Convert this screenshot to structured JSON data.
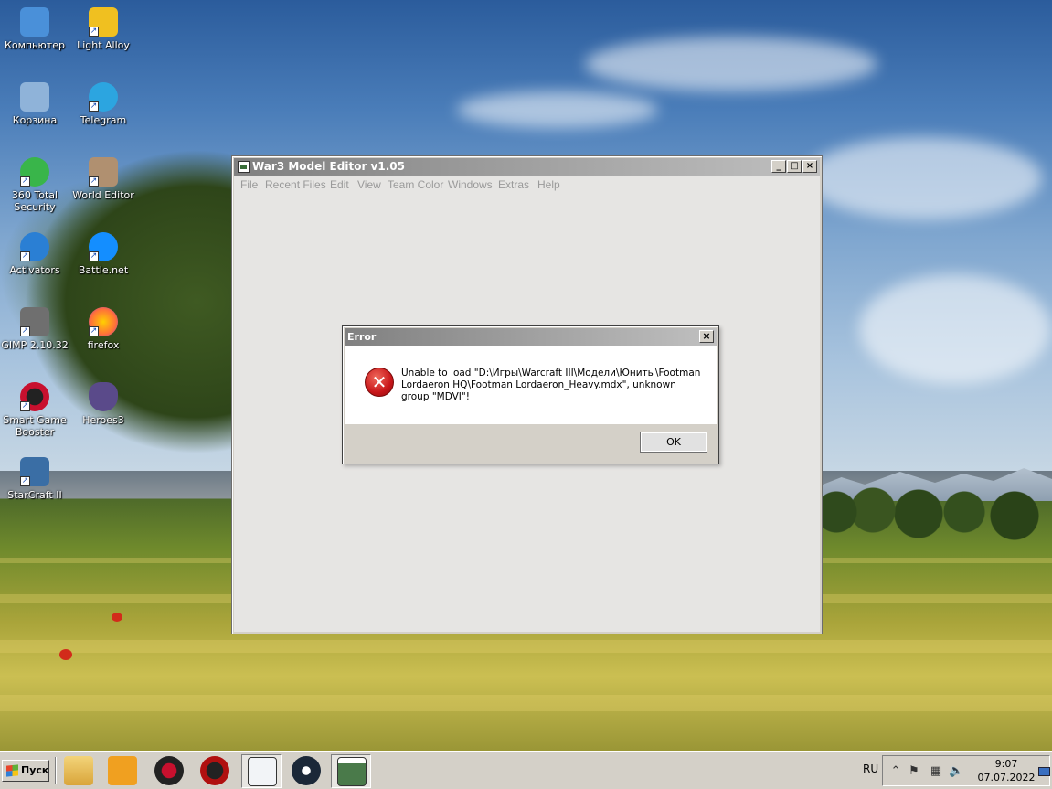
{
  "desktop": {
    "icons": [
      {
        "label": "Компьютер",
        "icon": "computer-icon",
        "color": "#4a90d9"
      },
      {
        "label": "Light Alloy",
        "icon": "light-alloy-icon",
        "color": "#f0c020"
      },
      {
        "label": "Корзина",
        "icon": "recycle-bin-icon",
        "color": "#8fb3d9"
      },
      {
        "label": "Telegram",
        "icon": "telegram-icon",
        "color": "#2ca5e0"
      },
      {
        "label": "360 Total Security",
        "icon": "360-security-icon",
        "color": "#39b54a"
      },
      {
        "label": "World Editor",
        "icon": "world-editor-icon",
        "color": "#b09070"
      },
      {
        "label": "Activators",
        "icon": "activators-icon",
        "color": "#2a7fd4"
      },
      {
        "label": "Battle.net",
        "icon": "battle-net-icon",
        "color": "#148eff"
      },
      {
        "label": "GIMP 2.10.32",
        "icon": "gimp-icon",
        "color": "#6f6f6f"
      },
      {
        "label": "firefox",
        "icon": "firefox-icon",
        "color": "#ff7139"
      },
      {
        "label": "Smart Game Booster",
        "icon": "game-booster-icon",
        "color": "#c8102e"
      },
      {
        "label": "Heroes3",
        "icon": "heroes3-icon",
        "color": "#5a4a8a"
      },
      {
        "label": "StarCraft II",
        "icon": "starcraft-icon",
        "color": "#3a6ea5"
      }
    ]
  },
  "main_window": {
    "title": "War3 Model Editor v1.05",
    "controls": {
      "minimize": "_",
      "maximize": "□",
      "close": "×"
    },
    "menu": [
      "File",
      "Recent Files",
      "Edit",
      "View",
      "Team Color",
      "Windows",
      "Extras",
      "Help"
    ]
  },
  "error_dialog": {
    "title": "Error",
    "close": "×",
    "message": "Unable to load \"D:\\Игры\\Warcraft III\\Модели\\Юниты\\Footman Lordaeron HQ\\Footman Lordaeron_Heavy.mdx\", unknown group \"MDVI\"!",
    "icon_symbol": "✕",
    "ok_label": "OK"
  },
  "taskbar": {
    "start_label": "Пуск",
    "apps": [
      {
        "icon": "explorer-icon",
        "color": "#e8c060"
      },
      {
        "icon": "media-player-icon",
        "color": "#f0a020"
      },
      {
        "icon": "game-booster-icon",
        "color": "#c8102e"
      },
      {
        "icon": "razer-cortex-icon",
        "color": "#b01010"
      },
      {
        "icon": "notepad-icon",
        "color": "#dfe6ee"
      },
      {
        "icon": "steam-icon",
        "color": "#1b2838"
      },
      {
        "icon": "war3-model-editor-icon",
        "color": "#4a7a4a"
      }
    ],
    "language": "RU",
    "clock_time": "9:07",
    "clock_date": "07.07.2022"
  }
}
